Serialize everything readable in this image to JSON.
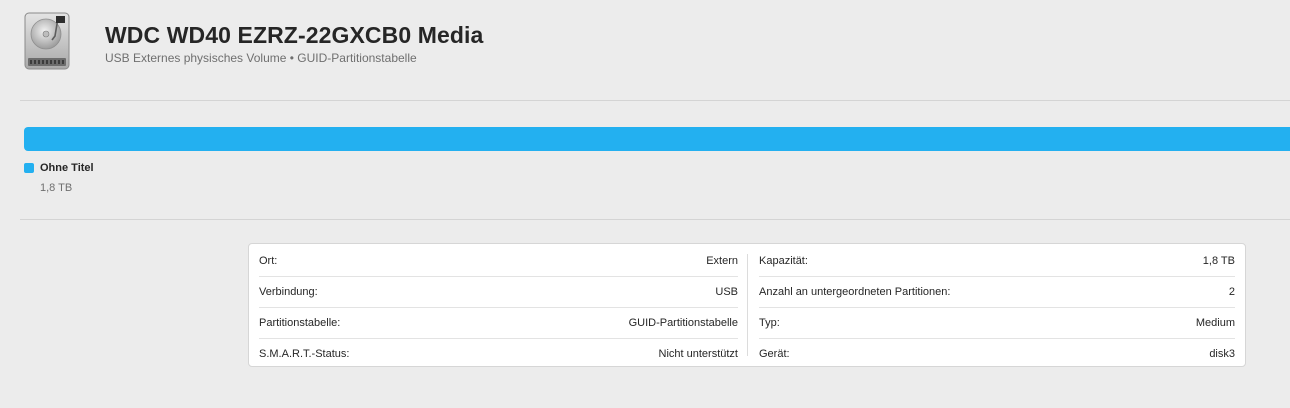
{
  "disk": {
    "title": "WDC WD40 EZRZ-22GXCB0 Media",
    "subtitle": "USB Externes physisches Volume • GUID-Partitionstabelle",
    "icon": "hard-drive-icon"
  },
  "usage": {
    "color": "#23b0f0",
    "volumes": [
      {
        "name": "Ohne Titel",
        "size": "1,8 TB",
        "fraction": 1.0
      }
    ]
  },
  "info": {
    "left": [
      {
        "label": "Ort:",
        "value": "Extern"
      },
      {
        "label": "Verbindung:",
        "value": "USB"
      },
      {
        "label": "Partitionstabelle:",
        "value": "GUID-Partitionstabelle"
      },
      {
        "label": "S.M.A.R.T.-Status:",
        "value": "Nicht unterstützt"
      }
    ],
    "right": [
      {
        "label": "Kapazität:",
        "value": "1,8 TB"
      },
      {
        "label": "Anzahl an untergeordneten Partitionen:",
        "value": "2"
      },
      {
        "label": "Typ:",
        "value": "Medium"
      },
      {
        "label": "Gerät:",
        "value": "disk3"
      }
    ]
  }
}
